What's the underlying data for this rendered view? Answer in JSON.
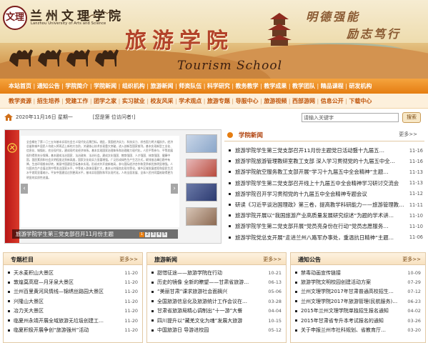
{
  "banner": {
    "university_name": "兰州文理学院",
    "university_en": "Lanzhou University of Arts and Science",
    "school_name_cn": "旅游学院",
    "school_name_en": "Tourism School",
    "motto_1": "明德强能",
    "motto_2": "励志笃行",
    "logo_text": "文理"
  },
  "nav_primary": [
    "本站首页",
    "通知公告",
    "学院简介",
    "学院新闻",
    "组织机构",
    "旅游新闻",
    "师资队伍",
    "科学研究",
    "教务教学",
    "教学成果",
    "教学团队",
    "精品课程",
    "研发机构"
  ],
  "nav_secondary": [
    "教学资源",
    "招生培养",
    "党建工作",
    "团学之家",
    "实习就业",
    "校友风采",
    "学术观点",
    "旅游专题",
    "导服中心",
    "旅游视频",
    "西部游网",
    "信息公开",
    "下载中心"
  ],
  "info": {
    "date": "2020年11月16日  星期一",
    "visitors": "[您是第 位访问者!]",
    "search_placeholder": "请输入关键字",
    "search_button": "搜索"
  },
  "slideshow": {
    "caption": "旅游学院学生第三党支部召开11月份主题",
    "doc_text": "全会概在了第二〇三五年基本实现社会主义现代化远景目标。就此，我国经济实力、科技实力、综合国力将大幅跃升，经济总量和城乡居民人均收入将再迈上新的大台阶，关键核心技术实现重大突破，进入创新型国家前列。基本实现新型工业化、信息化、城镇化、农业现代化，建成现代化经济体系。基本实现国家治理体系和治理能力现代化，人民平等参与、平等发展权利得到充分保障，基本建成法治国家、法治政府、法治社会。建成文化强国、教育强国、人才强国、体育强国、健康中国，国民素质和社会文明程度达到新高度，国家文化软实力显著增强。广泛形成绿色生产生活方式，碳排放达峰后稳中有降，生态环境根本好转，美丽中国建设目标基本实现。形成对外开放新格局，参与国际经济合作和竞争新优势明显增强。人均国内生产总值达到中等发达国家水平，中等收入群体显著扩大，基本公共服务实现均等化，城乡区域发展差距和居民生活水平差距显著缩小。平安中国建设达到更高水平，基本实现国防和军队现代化。人的全面发展、全体人民共同富裕取得更为明显的实质性进展。",
    "pages": [
      "1",
      "2",
      "3",
      "4",
      "5"
    ]
  },
  "college_news": {
    "title": "学院新闻",
    "more": "更多>>",
    "items": [
      {
        "t": "旅游学院学生第三党支部召开11月份主题党日活动暨十九届五…",
        "d": "11-16"
      },
      {
        "t": "旅游学院旅游管理教研室教工支部 深入学习贯彻党的十九届五中全…",
        "d": "11-16"
      },
      {
        "t": "旅游学院航空服务教工支部开展“学习十九届五中全会精神”主题…",
        "d": "11-13"
      },
      {
        "t": "旅游学院学生第二党支部召开线上十九届五中全会精神学习研讨交流会",
        "d": "11-13"
      },
      {
        "t": "旅游学院召开学习贯彻党的十九届五中全会精神专题会议",
        "d": "11-12"
      },
      {
        "t": "研读《习近平谈治国理政》第三卷，提高教学科研能力——旅游管理教…",
        "d": "11-11"
      },
      {
        "t": "旅游学院开展以“我国旅游产业高质量发展研究综述”为题的学术讲…",
        "d": "11-10"
      },
      {
        "t": "旅游学院学生第二党支部开展“党员亮身份在行动”党员志愿服务…",
        "d": "11-10"
      },
      {
        "t": "旅游学院党总支开展“走进兰州八路军办事处，重温抗日精神”主题…",
        "d": "11-06"
      }
    ]
  },
  "special_column": {
    "title": "专题栏目",
    "more": "更多>>",
    "items": [
      {
        "t": "天水麦积山大景区",
        "d": "11-20"
      },
      {
        "t": "敦煌莫高窟—月牙泉大景区",
        "d": "11-20"
      },
      {
        "t": "兰州百里黄河风情线—锦绣丝路园大景区",
        "d": "11-20"
      },
      {
        "t": "兴隆山大景区",
        "d": "11-20"
      },
      {
        "t": "冶力关大景区",
        "d": "11-20"
      },
      {
        "t": "临夏州永靖开展全域旅游无垃圾创建工…",
        "d": "11-20"
      },
      {
        "t": "临夏积极开展争创“旅游强州”活动",
        "d": "11-20"
      }
    ]
  },
  "tourism_news": {
    "title": "旅游新闻",
    "more": "更多>>",
    "items": [
      {
        "t": "甜惜征途——旅游学院在行动",
        "d": "10-21"
      },
      {
        "t": "历史的镜像 全新的瞭望——甘肃省旅游…",
        "d": "06-13"
      },
      {
        "t": "“美丽甘肃”课求旅游社会面摘兴",
        "d": "05-06"
      },
      {
        "t": "全国旅游信息化及旅游统计工作会议在…",
        "d": "03-28"
      },
      {
        "t": "甘肃省旅游局精心调制出“十一游”大餐",
        "d": "04-04"
      },
      {
        "t": "四川提升以“藏羌文化为魂”发展大旅游",
        "d": "10-15"
      },
      {
        "t": "中国旅游日 导游进校园",
        "d": "05-12"
      }
    ]
  },
  "notices": {
    "title": "通知公告",
    "more": "更多>>",
    "items": [
      {
        "t": "禁毒动画宣传链接",
        "d": "10-09"
      },
      {
        "t": "旅游学院文明校园创建活动方案",
        "d": "07-29"
      },
      {
        "t": "兰州文理学院2017年甘肃普通高校招生…",
        "d": "07-12"
      },
      {
        "t": "兰州文理学院2017年旅游管理(民航服务)…",
        "d": "06-23"
      },
      {
        "t": "2015年兰州文理学院单独招生报名通知",
        "d": "04-02"
      },
      {
        "t": "2015年甘肃省专升本考试报名的通知",
        "d": "03-26"
      },
      {
        "t": "关于申报兰州市社科规划、省教育厅…",
        "d": "03-20"
      }
    ]
  }
}
